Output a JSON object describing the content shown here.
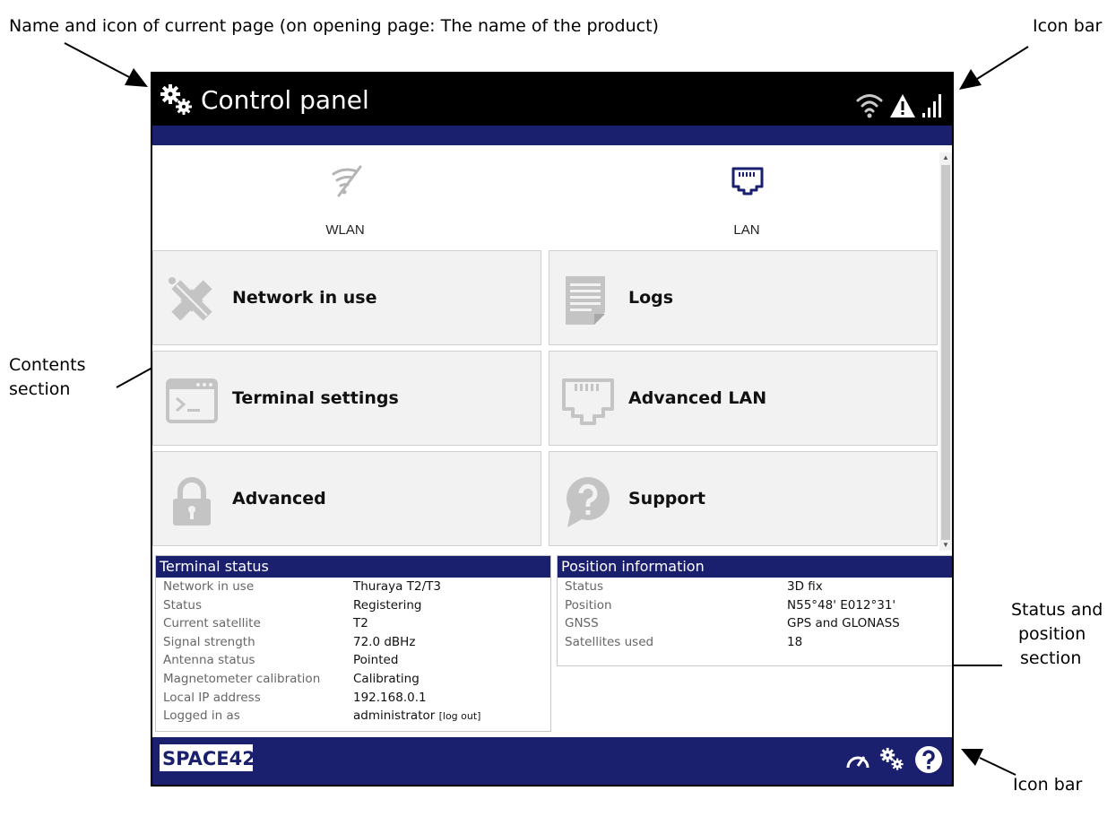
{
  "annotations": {
    "title_note": "Name and icon of current page (on opening page: The name of the product)",
    "icon_bar_top": "Icon bar",
    "contents_section": [
      "Contents",
      "section"
    ],
    "status_position_section": [
      "Status and",
      "position",
      "section"
    ],
    "icon_bar_bottom": "Icon bar"
  },
  "header": {
    "title": "Control panel",
    "title_icon": "gears-icon",
    "status_icons": [
      "wifi-icon",
      "warning-icon",
      "signal-strength-icon"
    ]
  },
  "quick_links": [
    {
      "label": "WLAN",
      "icon": "wlan-disabled-icon"
    },
    {
      "label": "LAN",
      "icon": "lan-port-icon"
    }
  ],
  "tiles": [
    {
      "label": "Network in use",
      "icon": "satellite-icon"
    },
    {
      "label": "Logs",
      "icon": "document-icon"
    },
    {
      "label": "Terminal settings",
      "icon": "terminal-icon"
    },
    {
      "label": "Advanced LAN",
      "icon": "ethernet-port-icon"
    },
    {
      "label": "Advanced",
      "icon": "lock-icon"
    },
    {
      "label": "Support",
      "icon": "question-bubble-icon"
    }
  ],
  "terminal_status": {
    "title": "Terminal status",
    "rows": [
      {
        "key": "Network in use",
        "value": "Thuraya T2/T3"
      },
      {
        "key": "Status",
        "value": "Registering"
      },
      {
        "key": "Current satellite",
        "value": "T2"
      },
      {
        "key": "Signal strength",
        "value": "72.0 dBHz"
      },
      {
        "key": "Antenna status",
        "value": "Pointed"
      },
      {
        "key": "Magnetometer calibration",
        "value": "Calibrating"
      },
      {
        "key": "Local IP address",
        "value": "192.168.0.1"
      },
      {
        "key": "Logged in as",
        "value": "administrator",
        "link": "[log out]"
      }
    ]
  },
  "position_info": {
    "title": "Position information",
    "rows": [
      {
        "key": "Status",
        "value": "3D fix"
      },
      {
        "key": "Position",
        "value": "N55°48' E012°31'"
      },
      {
        "key": "GNSS",
        "value": "GPS and GLONASS"
      },
      {
        "key": "Satellites used",
        "value": "18"
      }
    ]
  },
  "footer": {
    "logo_text": "SPACE42",
    "icons": [
      "dashboard-icon",
      "settings-gears-icon",
      "help-icon"
    ]
  },
  "colors": {
    "title_bar": "#000000",
    "accent_blue": "#1a1f6e",
    "tile_bg": "#f2f2f2",
    "icon_grey": "#c4c4c4"
  }
}
